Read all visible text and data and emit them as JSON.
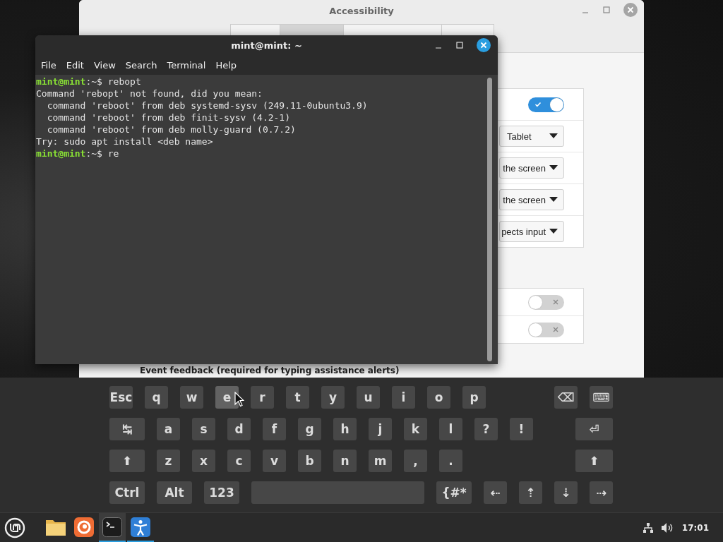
{
  "accessibility_window": {
    "title": "Accessibility",
    "tabs": [
      {
        "selected": false
      },
      {
        "selected": true
      },
      {
        "selected": false
      },
      {
        "selected": false
      }
    ],
    "settings_1": [
      {
        "kind": "switch",
        "on": true
      },
      {
        "kind": "dropdown",
        "value": "Tablet"
      },
      {
        "kind": "dropdown",
        "value": "the screen"
      },
      {
        "kind": "dropdown",
        "value": "the screen"
      },
      {
        "kind": "dropdown",
        "value": "pects input"
      }
    ],
    "settings_2": [
      {
        "kind": "switch",
        "on": false
      },
      {
        "kind": "switch",
        "on": false
      }
    ],
    "section_label": "Event feedback (required for typing assistance alerts)"
  },
  "terminal": {
    "title": "mint@mint: ~",
    "menu": [
      "File",
      "Edit",
      "View",
      "Search",
      "Terminal",
      "Help"
    ],
    "lines": [
      {
        "kind": "prompt",
        "user": "mint@mint",
        "path": ":~$",
        "command": " rebopt"
      },
      {
        "kind": "output",
        "text": "Command 'rebopt' not found, did you mean:"
      },
      {
        "kind": "output",
        "text": "  command 'reboot' from deb systemd-sysv (249.11-0ubuntu3.9)"
      },
      {
        "kind": "output",
        "text": "  command 'reboot' from deb finit-sysv (4.2-1)"
      },
      {
        "kind": "output",
        "text": "  command 'reboot' from deb molly-guard (0.7.2)"
      },
      {
        "kind": "output",
        "text": "Try: sudo apt install <deb name>"
      },
      {
        "kind": "prompt",
        "user": "mint@mint",
        "path": ":~$",
        "command": " re"
      }
    ]
  },
  "keyboard": {
    "rows": [
      {
        "left": [
          {
            "label": "Esc",
            "kind": "key",
            "pressed": false
          },
          {
            "label": "q",
            "kind": "key",
            "pressed": false
          },
          {
            "label": "w",
            "kind": "key",
            "pressed": false
          },
          {
            "label": "e",
            "kind": "key",
            "pressed": true
          },
          {
            "label": "r",
            "kind": "key",
            "pressed": false
          },
          {
            "label": "t",
            "kind": "key",
            "pressed": false
          },
          {
            "label": "y",
            "kind": "key",
            "pressed": false
          },
          {
            "label": "u",
            "kind": "key",
            "pressed": false
          },
          {
            "label": "i",
            "kind": "key",
            "pressed": false
          },
          {
            "label": "o",
            "kind": "key",
            "pressed": false
          },
          {
            "label": "p",
            "kind": "key",
            "pressed": false
          }
        ],
        "right": [
          {
            "label": "⌫",
            "kind": "key",
            "pressed": false
          },
          {
            "label": "⌨",
            "kind": "key",
            "pressed": false
          }
        ]
      },
      {
        "left": [
          {
            "label": "↹",
            "kind": "wide",
            "pressed": false
          },
          {
            "label": "a",
            "kind": "key",
            "pressed": false
          },
          {
            "label": "s",
            "kind": "key",
            "pressed": false
          },
          {
            "label": "d",
            "kind": "key",
            "pressed": false
          },
          {
            "label": "f",
            "kind": "key",
            "pressed": false
          },
          {
            "label": "g",
            "kind": "key",
            "pressed": false
          },
          {
            "label": "h",
            "kind": "key",
            "pressed": false
          },
          {
            "label": "j",
            "kind": "key",
            "pressed": false
          },
          {
            "label": "k",
            "kind": "key",
            "pressed": false
          },
          {
            "label": "l",
            "kind": "key",
            "pressed": false
          },
          {
            "label": "?",
            "kind": "key",
            "pressed": false
          },
          {
            "label": "!",
            "kind": "key",
            "pressed": false
          }
        ],
        "right": [
          {
            "label": "⏎",
            "kind": "large",
            "pressed": false
          }
        ]
      },
      {
        "left": [
          {
            "label": "⬆",
            "kind": "wide",
            "pressed": false
          },
          {
            "label": "z",
            "kind": "key",
            "pressed": false
          },
          {
            "label": "x",
            "kind": "key",
            "pressed": false
          },
          {
            "label": "c",
            "kind": "key",
            "pressed": false
          },
          {
            "label": "v",
            "kind": "key",
            "pressed": false
          },
          {
            "label": "b",
            "kind": "key",
            "pressed": false
          },
          {
            "label": "n",
            "kind": "key",
            "pressed": false
          },
          {
            "label": "m",
            "kind": "key",
            "pressed": false
          },
          {
            "label": ",",
            "kind": "key",
            "pressed": false
          },
          {
            "label": ".",
            "kind": "key",
            "pressed": false
          }
        ],
        "right": [
          {
            "label": "⬆",
            "kind": "large",
            "pressed": false
          }
        ]
      },
      {
        "left": [
          {
            "label": "Ctrl",
            "kind": "wide",
            "pressed": false
          },
          {
            "label": "Alt",
            "kind": "wide",
            "pressed": false
          },
          {
            "label": "123",
            "kind": "wide",
            "pressed": false
          },
          {
            "kind": "space",
            "pressed": false
          },
          {
            "label": "{#*",
            "kind": "wide",
            "pressed": false
          },
          {
            "label": "⇠",
            "kind": "key",
            "pressed": false
          },
          {
            "label": "⇡",
            "kind": "key",
            "pressed": false
          },
          {
            "label": "⇣",
            "kind": "key",
            "pressed": false
          },
          {
            "label": "⇢",
            "kind": "key",
            "pressed": false
          }
        ],
        "right": []
      }
    ]
  },
  "taskbar": {
    "apps": [
      {
        "kind": "files",
        "running": false
      },
      {
        "kind": "browser",
        "running": false
      },
      {
        "kind": "terminal",
        "running": true
      },
      {
        "kind": "accessibility",
        "running": true
      }
    ],
    "clock": "17:01"
  }
}
